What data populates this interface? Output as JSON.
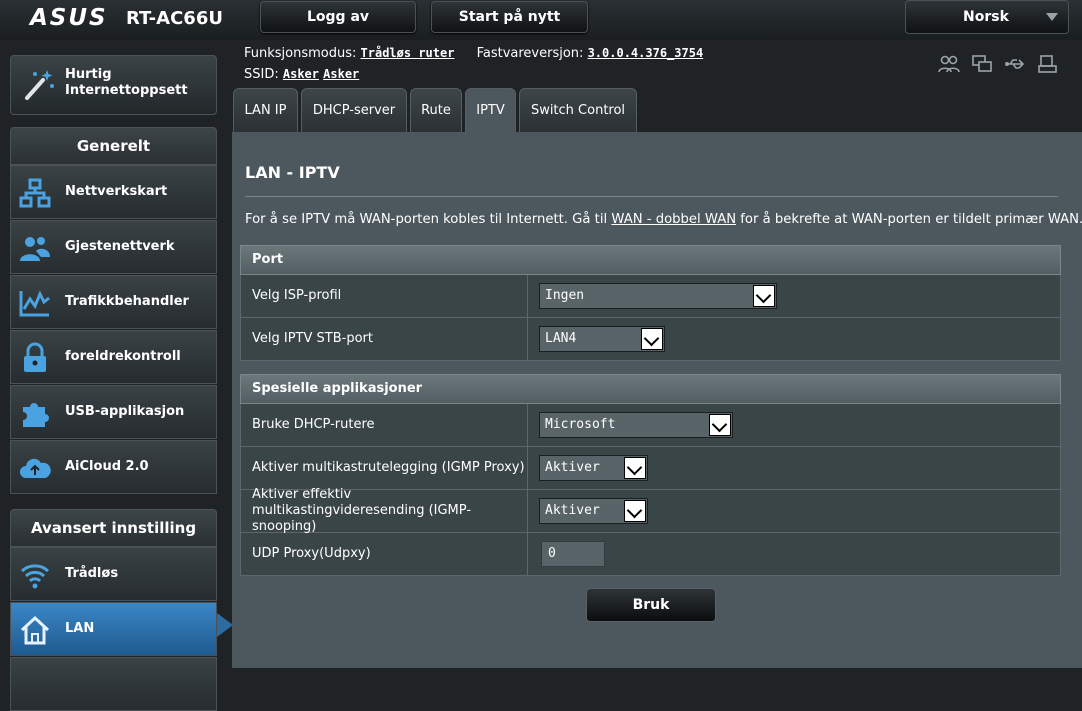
{
  "header": {
    "brand": "ASUS",
    "model": "RT-AC66U",
    "logout_label": "Logg av",
    "restart_label": "Start på nytt",
    "language": "Norsk"
  },
  "info": {
    "mode_label": "Funksjonsmodus:",
    "mode_value": "Trådløs ruter",
    "firmware_label": "Fastvareversjon:",
    "firmware_value": "3.0.0.4.376_3754",
    "ssid_label": "SSID:",
    "ssid_values": [
      "Asker",
      "Asker"
    ],
    "status_icons": [
      "clients-icon",
      "network-icon",
      "usb-icon",
      "printer-icon"
    ]
  },
  "sidebar": {
    "quick_setup": "Hurtig Internettoppsett",
    "general_heading": "Generelt",
    "general_items": [
      {
        "label": "Nettverkskart",
        "icon": "network-map-icon"
      },
      {
        "label": "Gjestenettverk",
        "icon": "guest-network-icon"
      },
      {
        "label": "Trafikkbehandler",
        "icon": "traffic-manager-icon"
      },
      {
        "label": "foreldrekontroll",
        "icon": "lock-icon"
      },
      {
        "label": "USB-applikasjon",
        "icon": "puzzle-icon"
      },
      {
        "label": "AiCloud 2.0",
        "icon": "cloud-icon"
      }
    ],
    "advanced_heading": "Avansert innstilling",
    "advanced_items": [
      {
        "label": "Trådløs",
        "icon": "wifi-icon"
      },
      {
        "label": "LAN",
        "icon": "home-icon",
        "active": true
      }
    ]
  },
  "tabs": [
    "LAN IP",
    "DHCP-server",
    "Rute",
    "IPTV",
    "Switch Control"
  ],
  "active_tab": "IPTV",
  "page": {
    "title": "LAN - IPTV",
    "desc_before": "For å se IPTV må WAN-porten kobles til Internett. Gå til ",
    "desc_link": "WAN - dobbel WAN",
    "desc_after": " for å bekrefte at WAN-porten er tildelt primær WAN."
  },
  "port_section": {
    "heading": "Port",
    "rows": [
      {
        "label": "Velg ISP-profil",
        "value": "Ingen"
      },
      {
        "label": "Velg IPTV STB-port",
        "value": "LAN4"
      }
    ]
  },
  "special_section": {
    "heading": "Spesielle applikasjoner",
    "rows": [
      {
        "label": "Bruke DHCP-rutere",
        "value": "Microsoft"
      },
      {
        "label": "Aktiver multikastrutelegging (IGMP Proxy)",
        "value": "Aktiver"
      },
      {
        "label": "Aktiver effektiv multikastingvideresending (IGMP-snooping)",
        "value": "Aktiver"
      },
      {
        "label": "UDP Proxy(Udpxy)",
        "value": "0"
      }
    ]
  },
  "apply_label": "Bruk",
  "colors": {
    "background": "#1f2326",
    "panel": "#4d585e",
    "active_item": "#2c6aa0",
    "icon_blue": "#4aa3e0"
  }
}
